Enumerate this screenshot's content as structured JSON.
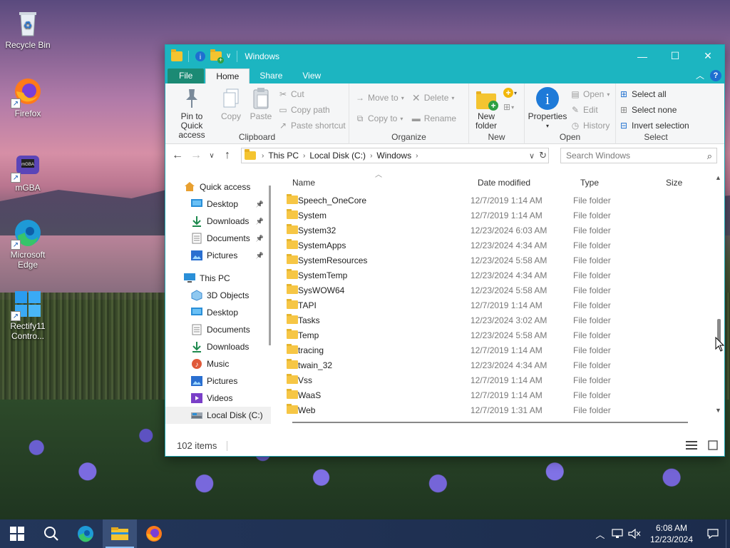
{
  "desktop": {
    "icons": [
      {
        "label": "Recycle Bin",
        "icon": "recycle-bin-icon"
      },
      {
        "label": "Firefox",
        "icon": "firefox-icon"
      },
      {
        "label": "mGBA",
        "icon": "mgba-icon"
      },
      {
        "label": "Microsoft Edge",
        "icon": "edge-icon"
      },
      {
        "label": "Rectify11 Contro...",
        "icon": "control-panel-icon"
      }
    ]
  },
  "window": {
    "title": "Windows",
    "controls": {
      "minimize": "—",
      "maximize": "☐",
      "close": "✕"
    }
  },
  "ribbon": {
    "tabs": [
      "File",
      "Home",
      "Share",
      "View"
    ],
    "clipboard": {
      "pin_label": "Pin to Quick access",
      "copy_label": "Copy",
      "paste_label": "Paste",
      "cut_label": "Cut",
      "copy_path_label": "Copy path",
      "paste_shortcut_label": "Paste shortcut",
      "group_label": "Clipboard"
    },
    "organize": {
      "move_to_label": "Move to",
      "copy_to_label": "Copy to",
      "delete_label": "Delete",
      "rename_label": "Rename",
      "group_label": "Organize"
    },
    "new": {
      "new_folder_label": "New folder",
      "group_label": "New"
    },
    "open": {
      "properties_label": "Properties",
      "open_label": "Open",
      "edit_label": "Edit",
      "history_label": "History",
      "group_label": "Open"
    },
    "select": {
      "select_all_label": "Select all",
      "select_none_label": "Select none",
      "invert_label": "Invert selection",
      "group_label": "Select"
    }
  },
  "address": {
    "crumbs": [
      "This PC",
      "Local Disk (C:)",
      "Windows"
    ],
    "search_placeholder": "Search Windows"
  },
  "nav": {
    "items": [
      {
        "label": "Quick access",
        "icon": "star-icon",
        "pinned": false
      },
      {
        "label": "Desktop",
        "icon": "desktop-icon",
        "pinned": true
      },
      {
        "label": "Downloads",
        "icon": "download-icon",
        "pinned": true
      },
      {
        "label": "Documents",
        "icon": "documents-icon",
        "pinned": true
      },
      {
        "label": "Pictures",
        "icon": "pictures-icon",
        "pinned": true
      },
      {
        "label": "This PC",
        "icon": "computer-icon",
        "pinned": false
      },
      {
        "label": "3D Objects",
        "icon": "cube-icon",
        "pinned": false
      },
      {
        "label": "Desktop",
        "icon": "desktop-icon",
        "pinned": false
      },
      {
        "label": "Documents",
        "icon": "documents-icon",
        "pinned": false
      },
      {
        "label": "Downloads",
        "icon": "download-icon",
        "pinned": false
      },
      {
        "label": "Music",
        "icon": "music-icon",
        "pinned": false
      },
      {
        "label": "Pictures",
        "icon": "pictures-icon",
        "pinned": false
      },
      {
        "label": "Videos",
        "icon": "videos-icon",
        "pinned": false
      },
      {
        "label": "Local Disk (C:)",
        "icon": "drive-icon",
        "pinned": false
      }
    ]
  },
  "columns": {
    "name": "Name",
    "date": "Date modified",
    "type": "Type",
    "size": "Size"
  },
  "files": [
    {
      "name": "Speech_OneCore",
      "date": "12/7/2019 1:14 AM",
      "type": "File folder"
    },
    {
      "name": "System",
      "date": "12/7/2019 1:14 AM",
      "type": "File folder"
    },
    {
      "name": "System32",
      "date": "12/23/2024 6:03 AM",
      "type": "File folder"
    },
    {
      "name": "SystemApps",
      "date": "12/23/2024 4:34 AM",
      "type": "File folder"
    },
    {
      "name": "SystemResources",
      "date": "12/23/2024 5:58 AM",
      "type": "File folder"
    },
    {
      "name": "SystemTemp",
      "date": "12/23/2024 4:34 AM",
      "type": "File folder"
    },
    {
      "name": "SysWOW64",
      "date": "12/23/2024 5:58 AM",
      "type": "File folder"
    },
    {
      "name": "TAPI",
      "date": "12/7/2019 1:14 AM",
      "type": "File folder"
    },
    {
      "name": "Tasks",
      "date": "12/23/2024 3:02 AM",
      "type": "File folder"
    },
    {
      "name": "Temp",
      "date": "12/23/2024 5:58 AM",
      "type": "File folder"
    },
    {
      "name": "tracing",
      "date": "12/7/2019 1:14 AM",
      "type": "File folder"
    },
    {
      "name": "twain_32",
      "date": "12/23/2024 4:34 AM",
      "type": "File folder"
    },
    {
      "name": "Vss",
      "date": "12/7/2019 1:14 AM",
      "type": "File folder"
    },
    {
      "name": "WaaS",
      "date": "12/7/2019 1:14 AM",
      "type": "File folder"
    },
    {
      "name": "Web",
      "date": "12/7/2019 1:31 AM",
      "type": "File folder"
    }
  ],
  "status": {
    "item_count": "102 items"
  },
  "taskbar": {
    "time": "6:08 AM",
    "date": "12/23/2024"
  },
  "colors": {
    "titlebar": "#1cb5c1",
    "file_tab": "#1b8a74",
    "folder": "#f6c645",
    "taskbar": "#1c2c4c"
  }
}
